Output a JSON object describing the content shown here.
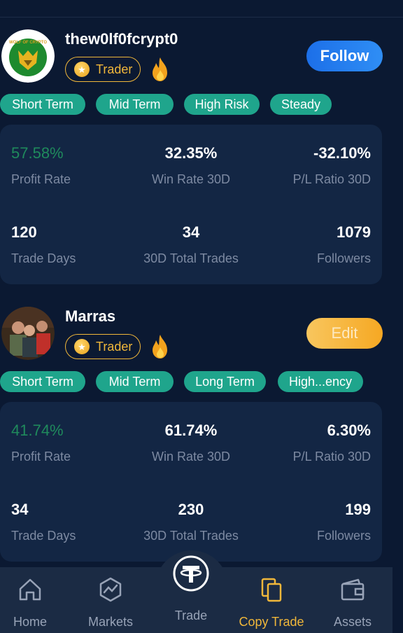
{
  "traders": [
    {
      "name": "thew0lf0fcrypt0",
      "avatar_text": "WOLF OF CRYPTO",
      "badge": "Trader",
      "action_label": "Follow",
      "tags": [
        "Short Term",
        "Mid Term",
        "High Risk",
        "Steady"
      ],
      "stats": {
        "profit_rate": {
          "value": "57.58%",
          "label": "Profit Rate"
        },
        "win_rate": {
          "value": "32.35%",
          "label": "Win Rate 30D"
        },
        "pl_ratio": {
          "value": "-32.10%",
          "label": "P/L Ratio 30D"
        },
        "trade_days": {
          "value": "120",
          "label": "Trade Days"
        },
        "total_trades": {
          "value": "34",
          "label": "30D Total Trades"
        },
        "followers": {
          "value": "1079",
          "label": "Followers"
        }
      }
    },
    {
      "name": "Marras",
      "badge": "Trader",
      "action_label": "Edit",
      "tags": [
        "Short Term",
        "Mid Term",
        "Long Term",
        "High...ency"
      ],
      "stats": {
        "profit_rate": {
          "value": "41.74%",
          "label": "Profit Rate"
        },
        "win_rate": {
          "value": "61.74%",
          "label": "Win Rate 30D"
        },
        "pl_ratio": {
          "value": "6.30%",
          "label": "P/L Ratio 30D"
        },
        "trade_days": {
          "value": "34",
          "label": "Trade Days"
        },
        "total_trades": {
          "value": "230",
          "label": "30D Total Trades"
        },
        "followers": {
          "value": "199",
          "label": "Followers"
        }
      }
    }
  ],
  "nav": {
    "home": "Home",
    "markets": "Markets",
    "trade": "Trade",
    "copy_trade": "Copy Trade",
    "assets": "Assets",
    "active": "copy_trade"
  },
  "colors": {
    "background": "#0b1932",
    "card": "#132644",
    "tag": "#1fa58c",
    "accent_gold": "#f0b73a",
    "follow_blue": "#1c6fe8",
    "profit_green": "#1f8a5c"
  },
  "icons": [
    "star-icon",
    "fire-icon",
    "home-icon",
    "markets-icon",
    "tether-icon",
    "copy-trade-icon",
    "wallet-icon"
  ]
}
